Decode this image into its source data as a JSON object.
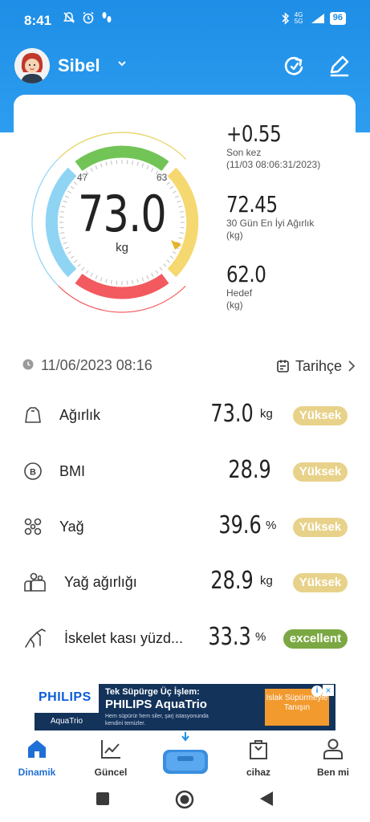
{
  "status_bar": {
    "time": "8:41",
    "network": "4G 5G",
    "battery": "96"
  },
  "header": {
    "username": "Sibel"
  },
  "gauge": {
    "value": "73.0",
    "unit": "kg",
    "tick_low": "47",
    "tick_high": "63"
  },
  "stats": [
    {
      "value": "+0.55",
      "label_line1": "Son kez",
      "label_line2": "(11/03 08:06:31/2023)"
    },
    {
      "value": "72.45",
      "label_line1": "30 Gün En İyi Ağırlık",
      "label_line2": "(kg)"
    },
    {
      "value": "62.0",
      "label_line1": "Hedef",
      "label_line2": "(kg)"
    }
  ],
  "measurement": {
    "datetime": "11/06/2023 08:16",
    "history_label": "Tarihçe"
  },
  "metrics": [
    {
      "label": "Ağırlık",
      "value": "73.0",
      "unit": "kg",
      "status": "Yüksek"
    },
    {
      "label": "BMI",
      "value": "28.9",
      "unit": "",
      "status": "Yüksek"
    },
    {
      "label": "Yağ",
      "value": "39.6",
      "unit": "%",
      "status": "Yüksek"
    },
    {
      "label": "Yağ ağırlığı",
      "value": "28.9",
      "unit": "kg",
      "status": "Yüksek"
    },
    {
      "label": "İskelet kası yüzd...",
      "value": "33.3",
      "unit": "%",
      "status": "excellent"
    }
  ],
  "ad": {
    "brand": "PHILIPS",
    "brand_sub": "AquaTrio",
    "line1": "Tek Süpürge Üç İşlem:",
    "line2": "PHILIPS AquaTrio",
    "line3": "Hem süpürür hem siler, şarj istasyonunda kendini temizler.",
    "cta": "Islak Süpürmeyle Tanışın",
    "info": "i",
    "close": "×"
  },
  "bottom_nav": [
    {
      "label": "Dinamik",
      "active": true
    },
    {
      "label": "Güncel",
      "active": false
    },
    {
      "label": "cihaz",
      "active": false
    },
    {
      "label": "Ben mi",
      "active": false
    }
  ],
  "colors": {
    "primary": "#1e8ee6",
    "gauge_green": "#72c456",
    "gauge_yellow": "#f5d870",
    "gauge_red": "#f25a5f",
    "gauge_blue": "#8fd4f3",
    "badge_high": "#e8d28a",
    "badge_excellent": "#7ba843"
  }
}
